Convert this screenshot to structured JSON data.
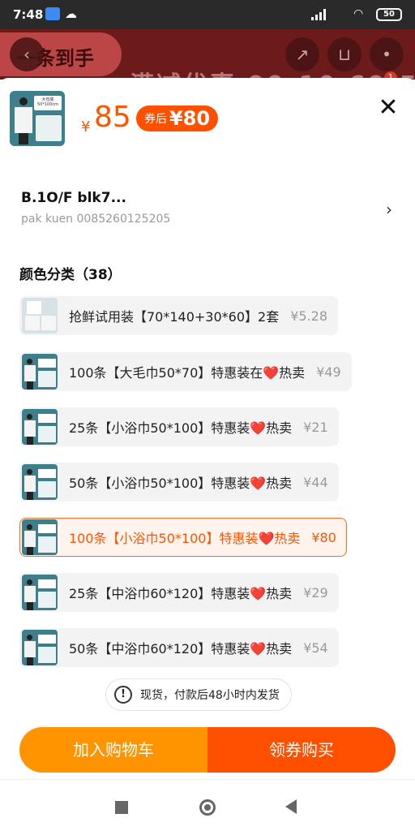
{
  "status_bar": {
    "time": "7:48",
    "battery": "50"
  },
  "background": {
    "banner_text": "一条到手",
    "promo_text": "满减优惠 99-10 69-5",
    "cart_badge": "1"
  },
  "sheet": {
    "price_symbol": "¥",
    "price": "85",
    "coupon_label": "券后",
    "coupon_amount": "¥80",
    "thumb_card_text": "大包装 50*100cm",
    "address_name": "B.1O/F blk7...",
    "address_sub": "pak kuen 0085260125205",
    "section_title": "颜色分类（38）",
    "options": [
      {
        "label": "抢鲜试用装【70*140+30*60】2套",
        "price": "¥5.28",
        "selected": false
      },
      {
        "label": "100条【大毛巾50*70】特惠装在❤️热卖",
        "price": "¥49",
        "selected": false
      },
      {
        "label": "25条【小浴巾50*100】特惠装❤️热卖",
        "price": "¥21",
        "selected": false
      },
      {
        "label": "50条【小浴巾50*100】特惠装❤️热卖",
        "price": "¥44",
        "selected": false
      },
      {
        "label": "100条【小浴巾50*100】特惠装❤️热卖",
        "price": "¥80",
        "selected": true
      },
      {
        "label": "25条【中浴巾60*120】特惠装❤️热卖",
        "price": "¥29",
        "selected": false
      },
      {
        "label": "50条【中浴巾60*120】特惠装❤️热卖",
        "price": "¥54",
        "selected": false
      }
    ],
    "shipping_note": "现货，付款后48小时内发货",
    "add_to_cart": "加入购物车",
    "buy_with_coupon": "领券购买"
  },
  "colors": {
    "accent": "#ff5000",
    "cart_button": "#ff9400"
  }
}
